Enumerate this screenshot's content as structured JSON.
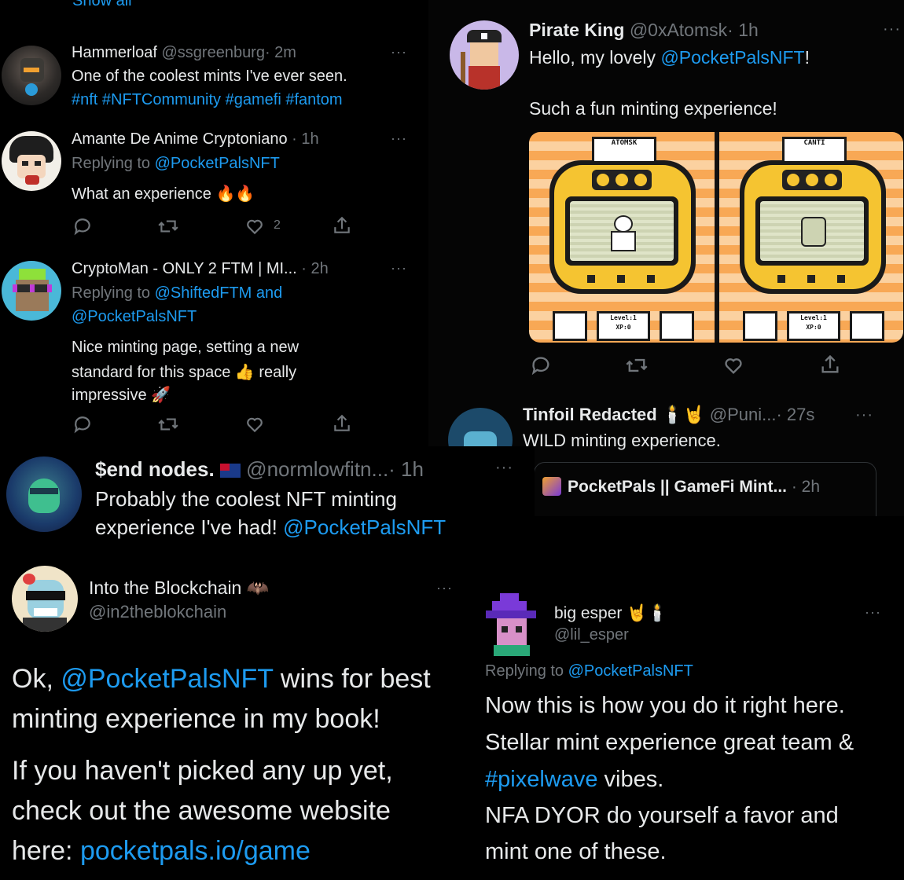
{
  "top_left": {
    "show_all": "Show all",
    "tweets": [
      {
        "name": "Hammerloaf",
        "handle": "@ssgreenburg",
        "time": "· 2m",
        "text": "One of the coolest mints I've ever seen.",
        "tags": "#nft #NFTCommunity #gamefi #fantom"
      },
      {
        "name": "Amante De Anime Cryptoniano",
        "time": "· 1h",
        "replying_prefix": "Replying to",
        "replying_to": "@PocketPalsNFT",
        "text": "What an experience",
        "emoji": "🔥🔥",
        "like_count": "2"
      },
      {
        "name": "CryptoMan - ONLY 2 FTM | MI...",
        "time": "· 2h",
        "replying_prefix": "Replying to",
        "replying_to_1": "@ShiftedFTM and",
        "replying_to_2": "@PocketPalsNFT",
        "text_1": "Nice minting page, setting a new",
        "text_2": "standard for this space",
        "text_2b": "really",
        "text_3": "impressive"
      }
    ]
  },
  "pirate": {
    "name": "Pirate King",
    "handle": "@0xAtomsk",
    "time": "· 1h",
    "text_1_prefix": "Hello, my lovely",
    "mention": "@PocketPalsNFT",
    "text_1_suffix": "!",
    "text_2": "Such a fun minting experience!",
    "device_left": {
      "label_top": "ATOMSK",
      "level": "Level:1",
      "xp": "XP:0"
    },
    "device_right": {
      "label_top": "CANTI",
      "level": "Level:1",
      "xp": "XP:0"
    }
  },
  "tinfoil": {
    "name": "Tinfoil Redacted",
    "handle": "@Puni...",
    "time": "· 27s",
    "text": "WILD minting experience.",
    "quote_name": "PocketPals || GameFi Mint...",
    "quote_time": "· 2h"
  },
  "send_nodes": {
    "name": "$end nodes.",
    "handle": "@normlowfitn...",
    "time": "· 1h",
    "text_1": "Probably the coolest NFT minting",
    "text_2_prefix": "experience I've had!",
    "mention": "@PocketPalsNFT"
  },
  "blockchain": {
    "name": "Into the Blockchain",
    "handle": "@in2theblokchain",
    "line1_prefix": "Ok,",
    "mention": "@PocketPalsNFT",
    "line1_suffix": "wins for best",
    "line2": "minting experience in my book!",
    "line3": "If you haven't picked any up yet,",
    "line4": "check out the awesome website",
    "line5_prefix": "here:",
    "link": "pocketpals.io/game"
  },
  "esper": {
    "name": "big esper",
    "handle": "@lil_esper",
    "replying_prefix": "Replying to",
    "replying_to": "@PocketPalsNFT",
    "line1": "Now this is how you do it right here.",
    "line2": "Stellar mint experience great team &",
    "line3_tag": "#pixelwave",
    "line3_suffix": "vibes.",
    "line4": "NFA DYOR do yourself a favor and",
    "line5": "mint one of these."
  },
  "more": "···",
  "colors": {
    "background": "#000000",
    "text": "#e7e9ea",
    "secondary": "#71767b",
    "link": "#1d9bf0",
    "device_yellow": "#f5c431",
    "device_orange": "#f7a24a"
  },
  "icons": [
    "reply-icon",
    "retweet-icon",
    "like-icon",
    "share-icon",
    "more-icon"
  ]
}
